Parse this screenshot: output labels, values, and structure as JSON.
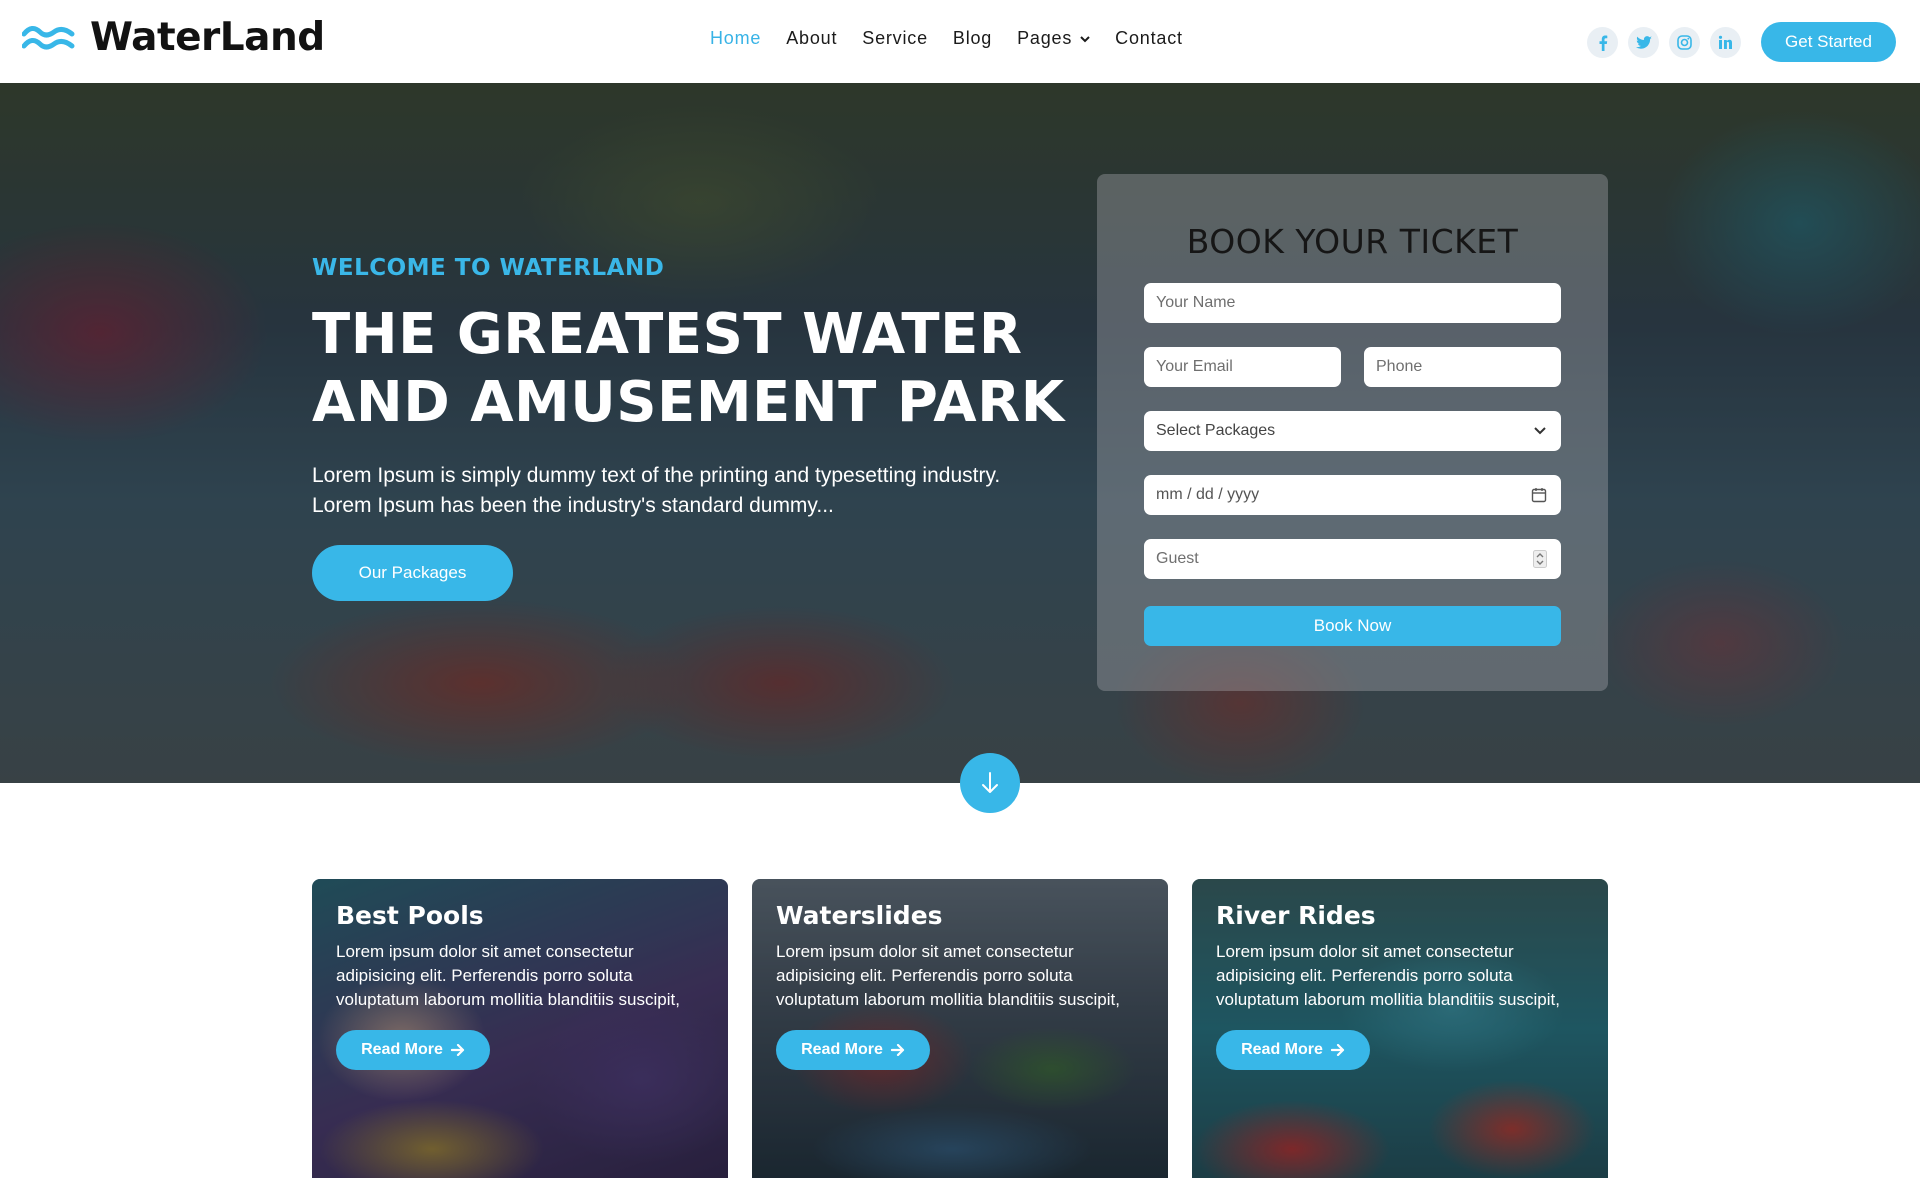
{
  "brand": {
    "name": "WaterLand",
    "logo_icon": "waves-icon"
  },
  "nav": {
    "items": [
      {
        "label": "Home",
        "active": true
      },
      {
        "label": "About"
      },
      {
        "label": "Service"
      },
      {
        "label": "Blog"
      },
      {
        "label": "Pages",
        "dropdown": true
      },
      {
        "label": "Contact"
      }
    ],
    "socials": [
      "facebook-icon",
      "twitter-icon",
      "instagram-icon",
      "linkedin-icon"
    ],
    "cta": "Get Started"
  },
  "hero": {
    "eyebrow": "WELCOME TO WATERLAND",
    "title_line1": "THE GREATEST WATER",
    "title_line2": "AND AMUSEMENT PARK",
    "lead_line1": "Lorem Ipsum is simply dummy text of the printing and typesetting industry.",
    "lead_line2": "Lorem Ipsum has been the industry's standard dummy...",
    "button": "Our Packages"
  },
  "booking": {
    "title": "BOOK YOUR TICKET",
    "name_placeholder": "Your Name",
    "email_placeholder": "Your Email",
    "phone_placeholder": "Phone",
    "packages_placeholder": "Select Packages",
    "date_placeholder": "mm / dd / yyyy",
    "guest_placeholder": "Guest",
    "submit": "Book Now"
  },
  "cards": [
    {
      "title": "Best Pools",
      "text": "Lorem ipsum dolor sit amet consectetur adipisicing elit. Perferendis porro soluta voluptatum laborum mollitia blanditiis suscipit,",
      "button": "Read More"
    },
    {
      "title": "Waterslides",
      "text": "Lorem ipsum dolor sit amet consectetur adipisicing elit. Perferendis porro soluta voluptatum laborum mollitia blanditiis suscipit,",
      "button": "Read More"
    },
    {
      "title": "River Rides",
      "text": "Lorem ipsum dolor sit amet consectetur adipisicing elit. Perferendis porro soluta voluptatum laborum mollitia blanditiis suscipit,",
      "button": "Read More"
    }
  ],
  "colors": {
    "accent": "#38b7e8",
    "text_dark": "#121212"
  }
}
